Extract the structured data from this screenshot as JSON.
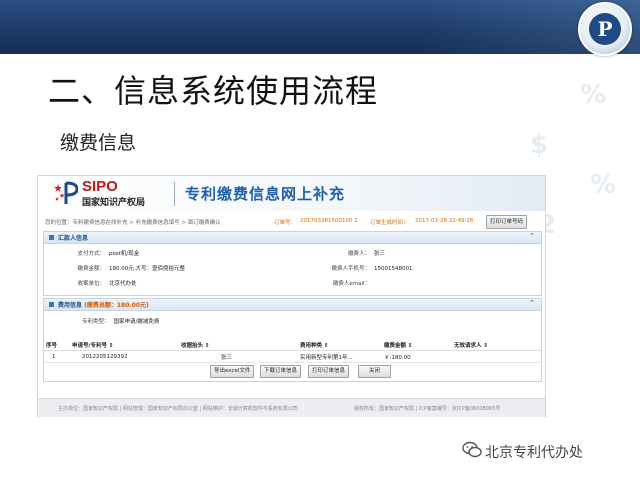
{
  "slide": {
    "title": "二、信息系统使用流程",
    "subtitle": "缴费信息",
    "watermark": "北京专利代办处",
    "logo_letter": "P"
  },
  "site": {
    "brand_en": "SIPO",
    "brand_cn": "国家知识产权局",
    "banner_title": "专利缴费信息网上补充"
  },
  "breadcrumb": {
    "prefix": "您的位置：专利缴费信息在线补充 > 补充缴费信息填写 > 面订缴费确认",
    "order_label": "订单号：",
    "order_no": "201703281500100 1",
    "created_label": "订单生成时间：",
    "created_at": "2017-03-28 22:49:26",
    "print_button": "打印订单号码"
  },
  "payer_panel": {
    "title": "汇款人信息",
    "toggle": "⌃",
    "fields": [
      {
        "key": "支付方式：",
        "value": "post机/现金"
      },
      {
        "key": "缴费金额：",
        "value": "180.00元 大写：壹佰捌拾元整"
      },
      {
        "key": "收案单位：",
        "value": "北京代办处"
      },
      {
        "key": "缴费人：",
        "value": "张三"
      },
      {
        "key": "缴费人手机号：",
        "value": "15001548001"
      },
      {
        "key": "缴费人email：",
        "value": ""
      }
    ]
  },
  "fee_panel": {
    "title": "费用信息",
    "total_label": "(缴费总额：180.00元)",
    "toggle": "⌃",
    "patent_type_label": "专利类型：",
    "patent_type": "国家申请/缴减免费",
    "columns": [
      "序号",
      "申请号/专利号 ⇕",
      "收据抬头 ⇕",
      "费用种类 ⇕",
      "缴费金额 ⇕",
      "无效请求人 ⇕"
    ],
    "rows": [
      [
        "1",
        "2012205129392",
        "张三",
        "实用新型专利第1年...",
        "￥:180.00",
        ""
      ]
    ],
    "buttons": [
      "导出excel文件",
      "下载订单信息",
      "打印订单信息",
      "关闭"
    ]
  },
  "footer": {
    "left": "主办单位：国家知识产权局  | 网站管理：国家知识产权局办公室  | 网站维护：长城计算机软件与系统有限公司",
    "right": "版权所有：国家知识产权局  | ICP备案编号：京ICP备06008065号"
  },
  "colors": {
    "header_blue": "#1d3b68",
    "brand_red": "#c6161c",
    "title_blue": "#1f5fae",
    "highlight_orange": "#e06a00"
  }
}
